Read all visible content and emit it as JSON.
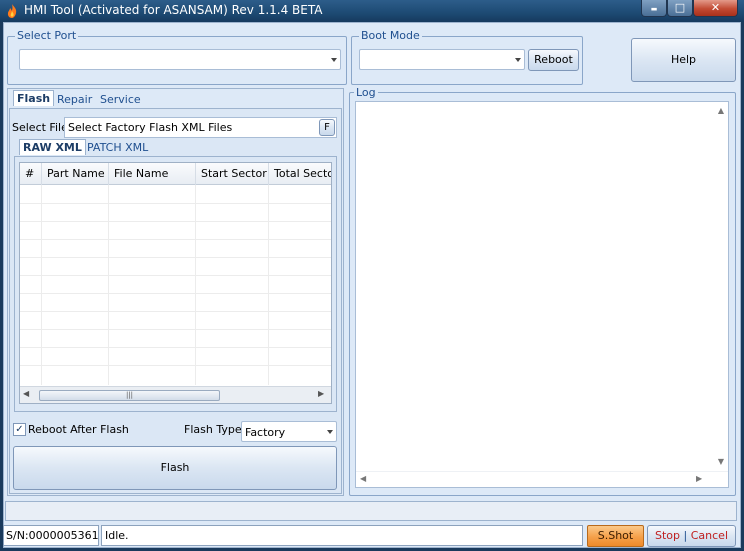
{
  "window": {
    "title": "HMI Tool (Activated for ASANSAM) Rev 1.1.4 BETA",
    "minimize_glyph": "▬",
    "maximize_glyph": "□",
    "close_glyph": "✕"
  },
  "select_port": {
    "label": "Select Port",
    "value": ""
  },
  "boot_mode": {
    "label": "Boot Mode",
    "value": "",
    "reboot_label": "Reboot"
  },
  "help_label": "Help",
  "tabs": [
    "Flash",
    "Repair",
    "Service"
  ],
  "flash": {
    "select_file_label": "Select File",
    "select_file_value": "Select Factory Flash XML Files",
    "file_button_label": "F",
    "subtabs": [
      "RAW XML",
      "PATCH XML"
    ],
    "columns": [
      "#",
      "Part Name",
      "File Name",
      "Start Sector",
      "Total Sector"
    ],
    "rows": [],
    "reboot_after_flash_label": "Reboot After Flash",
    "reboot_after_flash_checked": true,
    "flash_type_label": "Flash Type",
    "flash_type_value": "Factory",
    "flash_button_label": "Flash"
  },
  "log": {
    "label": "Log",
    "text": ""
  },
  "status": {
    "serial": "S/N:0000005361",
    "message": "Idle.",
    "screenshot_label": "S.Shot",
    "stop_label": "Stop",
    "separator": "|",
    "cancel_label": "Cancel"
  },
  "icons": {
    "scroll_left": "◀",
    "scroll_right": "▶",
    "scroll_up": "▲",
    "scroll_down": "▼",
    "grip": "|||",
    "check": "✓"
  },
  "colors": {
    "accent": "#1f4f8f",
    "background": "#dde9f7",
    "screenshot_button": "#f5a04a",
    "stop_cancel_text": "#c02020"
  }
}
